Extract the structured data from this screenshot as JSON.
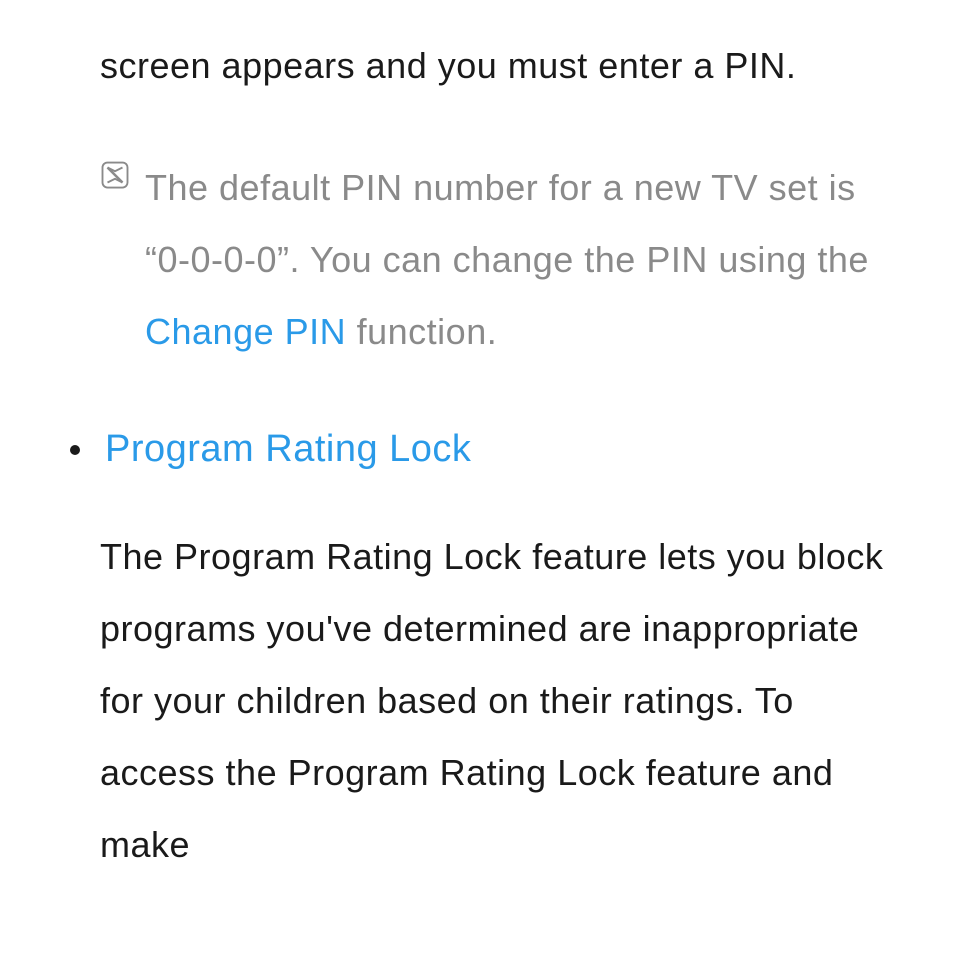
{
  "intro": "screen appears and you must enter a PIN.",
  "note": {
    "part1": "The default PIN number for a new TV set is “0-0-0-0”. You can change the PIN using the ",
    "highlight": "Change PIN",
    "part2": " function."
  },
  "section_heading": "Program Rating Lock",
  "body": "The Program Rating Lock feature lets you block programs you've determined are inappropriate for your children based on their ratings. To access the Program Rating Lock feature and make"
}
